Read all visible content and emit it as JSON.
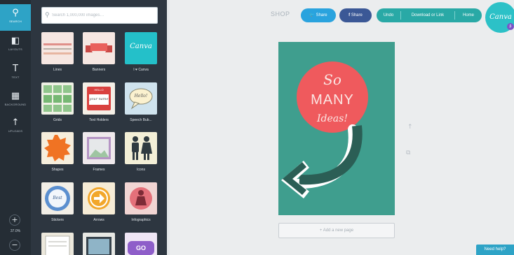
{
  "nav": {
    "items": [
      {
        "label": "SEARCH",
        "icon": "search-icon",
        "glyph": "⚲"
      },
      {
        "label": "LAYOUTS",
        "icon": "layouts-icon",
        "glyph": "◧"
      },
      {
        "label": "TEXT",
        "icon": "text-icon",
        "glyph": "T"
      },
      {
        "label": "BACKGROUND",
        "icon": "background-icon",
        "glyph": "▦"
      },
      {
        "label": "UPLOADS",
        "icon": "upload-icon",
        "glyph": "↑"
      }
    ],
    "zoom_in_glyph": "+",
    "zoom_level": "37.0%",
    "zoom_out_glyph": "−"
  },
  "panel": {
    "search_placeholder": "Search 1,000,000 images…",
    "search_glyph": "⚲",
    "tiles": [
      {
        "label": "Lines"
      },
      {
        "label": "Banners"
      },
      {
        "label": "I ♥ Canva",
        "tile_text": "Canva"
      },
      {
        "label": "Grids"
      },
      {
        "label": "Text Holders",
        "tile_text": "your name",
        "tile_badge": "HELLO"
      },
      {
        "label": "Speech Bub...",
        "tile_text": "Hello!"
      },
      {
        "label": "Shapes"
      },
      {
        "label": "Frames"
      },
      {
        "label": "Icons"
      },
      {
        "label": "Stickers",
        "tile_text": "Best"
      },
      {
        "label": "Arrows"
      },
      {
        "label": "Infographics"
      },
      {
        "label": ""
      },
      {
        "label": ""
      },
      {
        "label": "",
        "tile_text": "GO"
      }
    ]
  },
  "topbar": {
    "shop": "SHOP",
    "twitter": "Share",
    "facebook": "Share",
    "undo": "Undo",
    "download": "Download or Link",
    "home": "Home",
    "logo": "Canva",
    "badge": "β"
  },
  "canvas": {
    "line1": "So",
    "line2": "MANY",
    "line3": "Ideas!",
    "add_page": "+ Add a new page",
    "side_up": "↑",
    "side_copy": "⧉"
  },
  "help": "Need help?",
  "colors": {
    "rail": "#252d35",
    "panel": "#2d3640",
    "accent": "#2ea3c6",
    "page_bg": "#3f9e8e",
    "circle": "#ef5a5d",
    "arrow": "#2b5e55"
  }
}
